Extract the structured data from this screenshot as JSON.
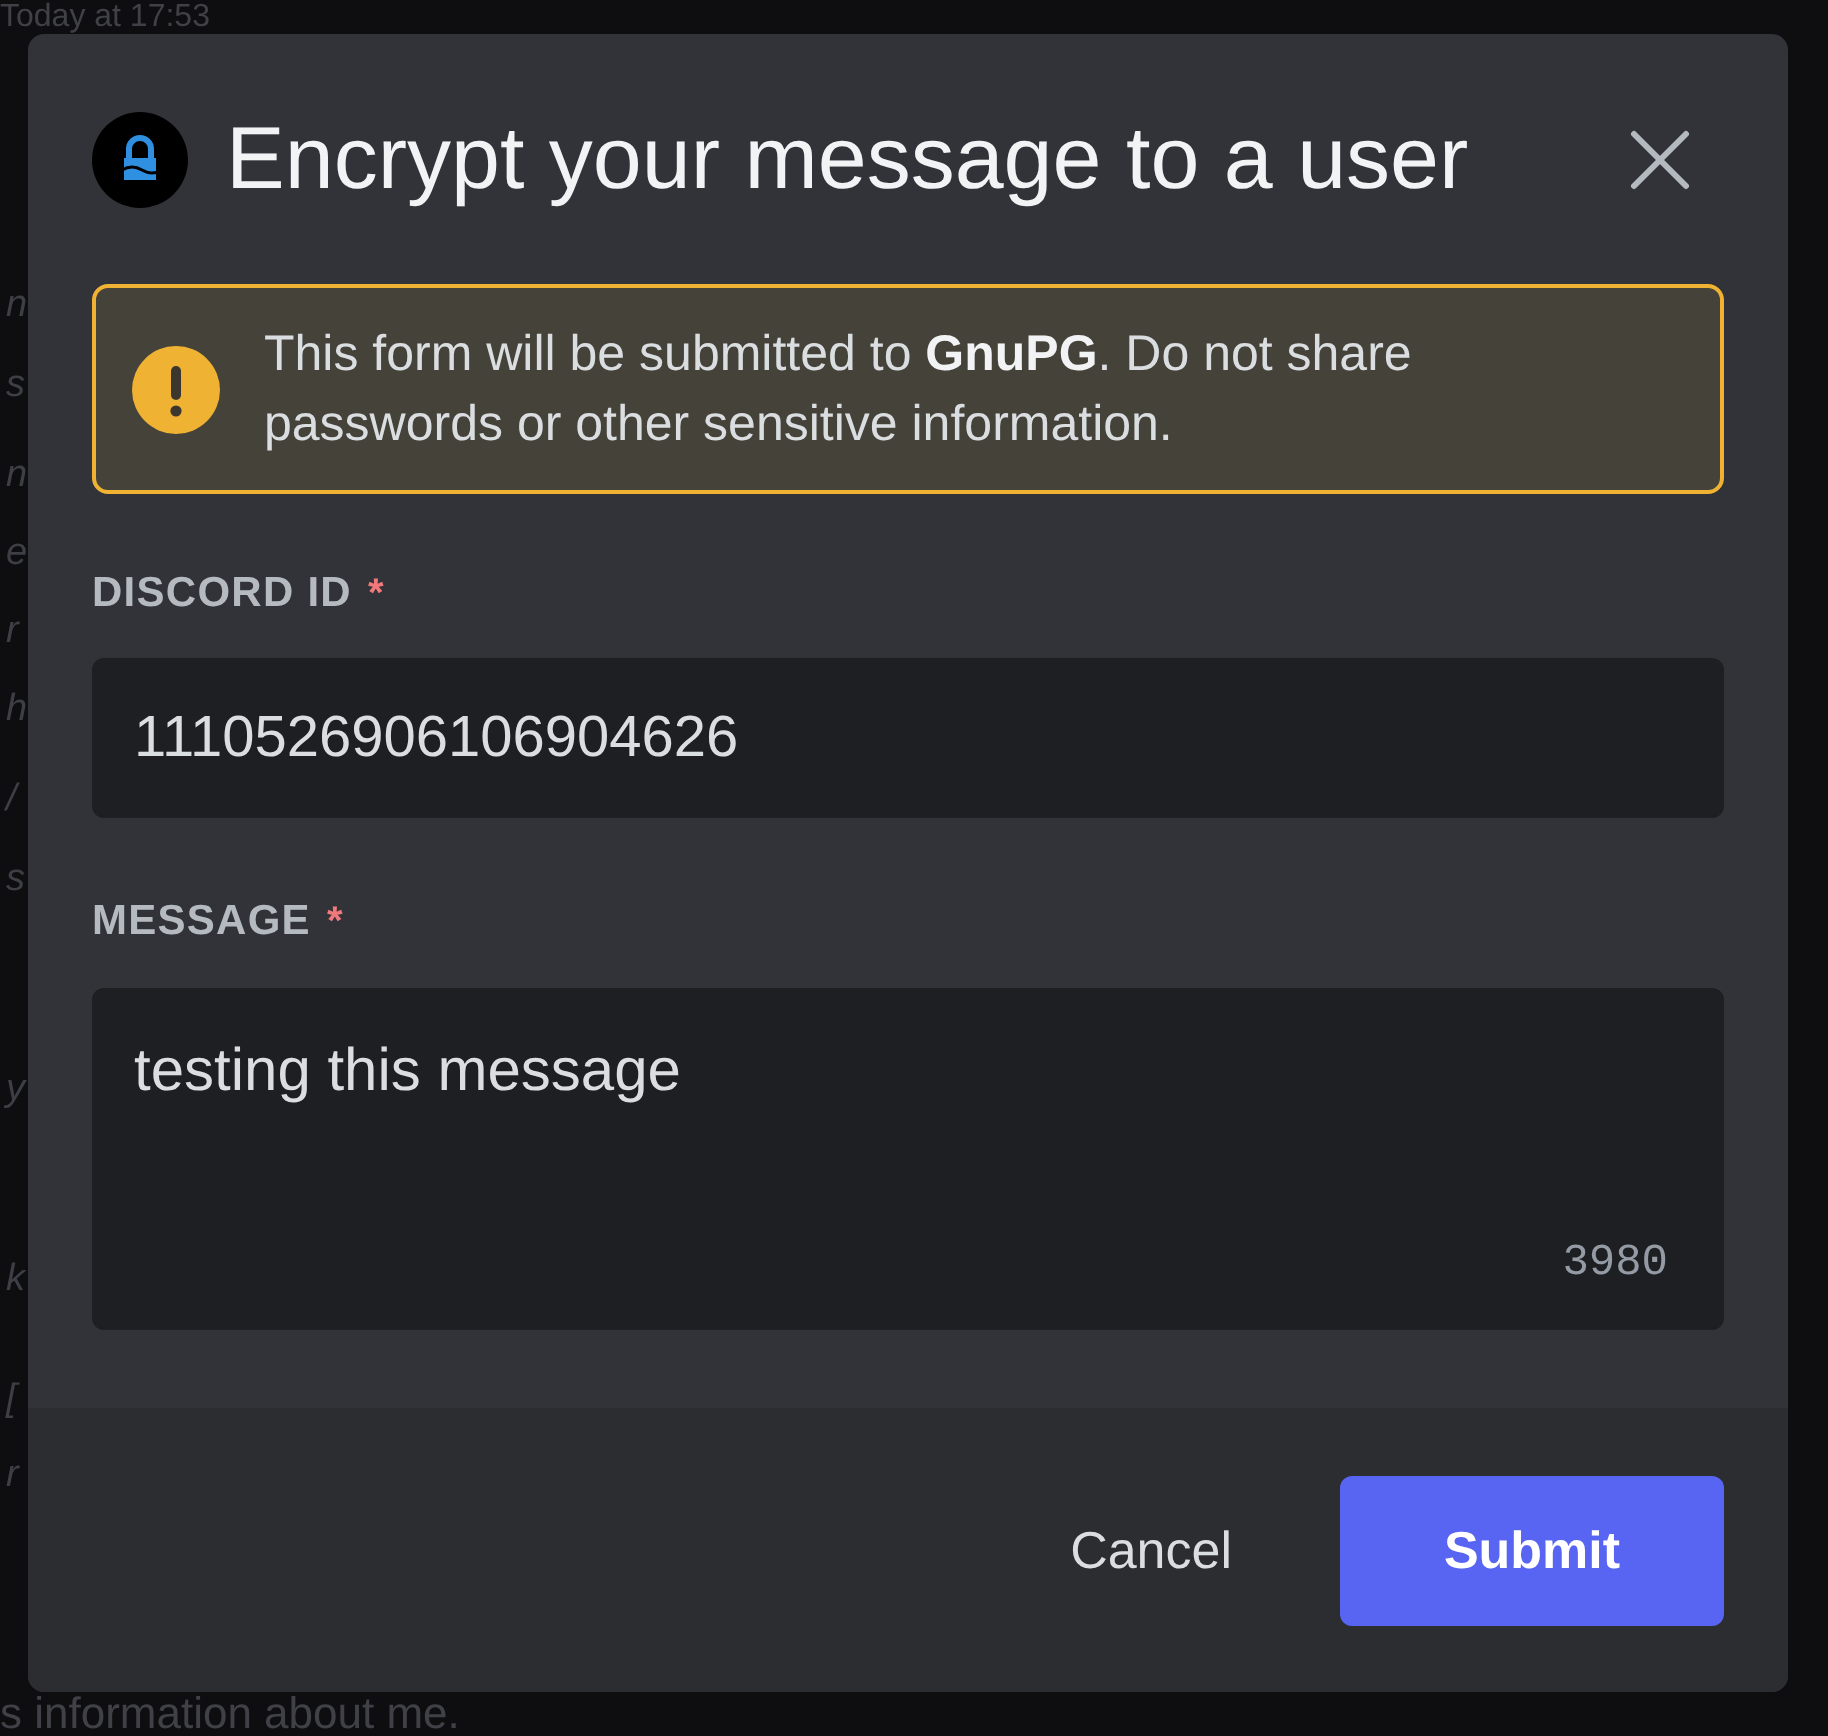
{
  "background": {
    "timestamp": "Today at 17:53",
    "side_fragments": [
      "n",
      "s",
      "n",
      "e",
      "r",
      "h",
      "/",
      "s",
      "y",
      "k",
      "[",
      "r"
    ],
    "bottom_text": "s information about me."
  },
  "dialog": {
    "title": "Encrypt your message to a user",
    "warning": {
      "text": "This form will be submitted to **GnuPG**. Do not share passwords or other sensitive information."
    },
    "fields": [
      {
        "kind": "input",
        "label": "DISCORD ID",
        "required_mark": "*",
        "value": "1110526906106904626"
      },
      {
        "kind": "textarea",
        "label": "MESSAGE",
        "required_mark": "*",
        "value": "testing this message",
        "counter": "3980"
      }
    ],
    "buttons": [
      {
        "kind": "secondary",
        "label": "Cancel"
      },
      {
        "kind": "primary",
        "label": "Submit"
      }
    ]
  }
}
